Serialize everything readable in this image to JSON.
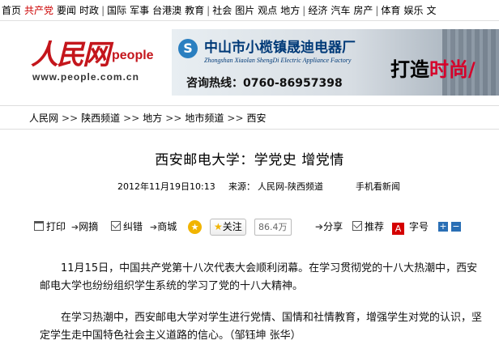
{
  "topnav": {
    "items": [
      {
        "label": "首页",
        "red": false,
        "sep_after": false
      },
      {
        "label": "共产党",
        "red": true,
        "sep_after": false
      },
      {
        "label": "要闻",
        "red": false,
        "sep_after": false
      },
      {
        "label": "时政",
        "red": false,
        "sep_after": true
      },
      {
        "label": "国际",
        "red": false,
        "sep_after": false
      },
      {
        "label": "军事",
        "red": false,
        "sep_after": false
      },
      {
        "label": "台港澳",
        "red": false,
        "sep_after": false
      },
      {
        "label": "教育",
        "red": false,
        "sep_after": true
      },
      {
        "label": "社会",
        "red": false,
        "sep_after": false
      },
      {
        "label": "图片",
        "red": false,
        "sep_after": false
      },
      {
        "label": "观点",
        "red": false,
        "sep_after": false
      },
      {
        "label": "地方",
        "red": false,
        "sep_after": true
      },
      {
        "label": "经济",
        "red": false,
        "sep_after": false
      },
      {
        "label": "汽车",
        "red": false,
        "sep_after": false
      },
      {
        "label": "房产",
        "red": false,
        "sep_after": true
      },
      {
        "label": "体育",
        "red": false,
        "sep_after": false
      },
      {
        "label": "娱乐",
        "red": false,
        "sep_after": false
      },
      {
        "label": "文",
        "red": false,
        "sep_after": false
      }
    ]
  },
  "logo": {
    "cn": "人民网",
    "en": "people",
    "url": "www.people.com.cn"
  },
  "ad": {
    "badge": "S",
    "company": "中山市小榄镇晟迪电器厂",
    "company_en": "Zhongshan Xiaolan ShengDi Electric Appliance Factory",
    "hotline": "咨询热线：0760-86957398",
    "slogan_prefix": "打造",
    "slogan_highlight": "时尚/"
  },
  "breadcrumb": [
    "人民网",
    "陕西频道",
    "地方",
    "地市频道",
    "西安"
  ],
  "breadcrumb_sep": ">>",
  "article": {
    "title": "西安邮电大学：学党史  增党情",
    "date": "2012年11月19日10:13",
    "source_label": "来源：",
    "source": "人民网-陕西频道",
    "mobile": "手机看新闻",
    "paragraphs": [
      "11月15日，中国共产党第十八次代表大会顺利闭幕。在学习贯彻党的十八大热潮中，西安邮电大学也纷纷组织学生系统的学习了党的十八大精神。",
      "在学习热潮中，西安邮电大学对学生进行党情、国情和社情教育，增强学生对党的认识，坚定学生走中国特色社会主义道路的信心。（邹钰坤 张华）"
    ]
  },
  "toolbar": {
    "print": "打印",
    "net_excerpt": "网摘",
    "correction": "纠错",
    "mall": "商城",
    "follow": "关注",
    "follow_count": "86.4万",
    "share": "分享",
    "recommend": "推荐",
    "font_size": "字号",
    "font_plus": "+",
    "font_minus": "−"
  }
}
